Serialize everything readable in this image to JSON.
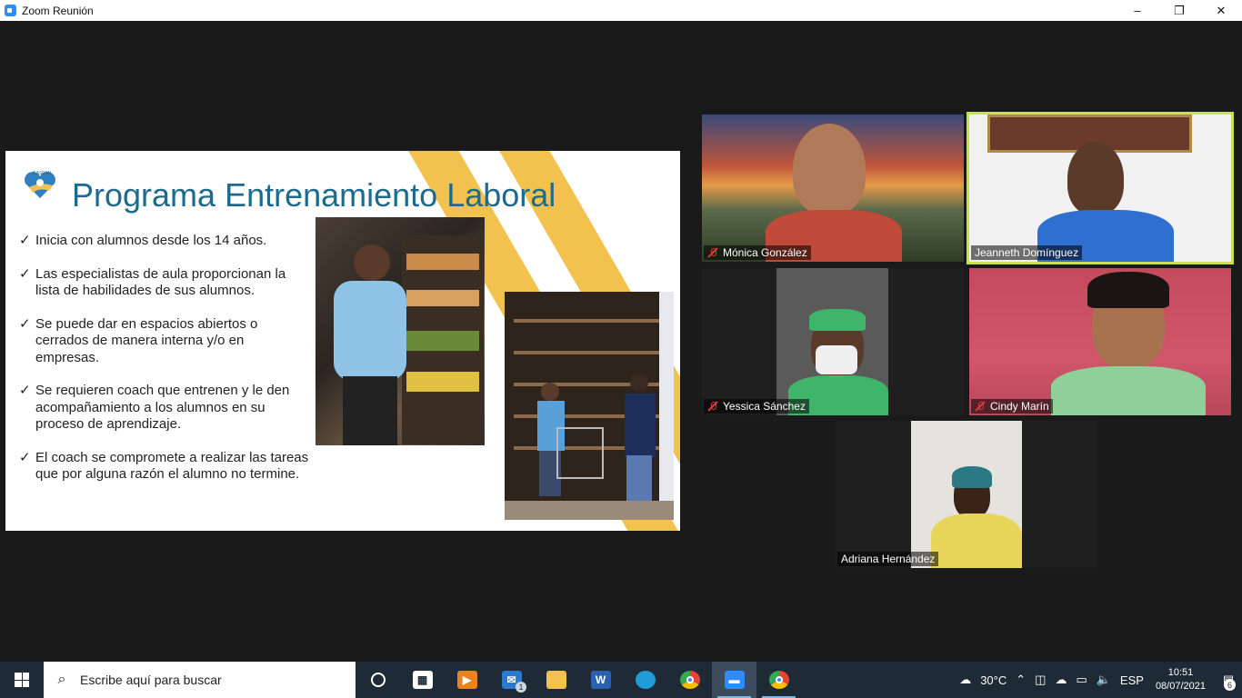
{
  "window": {
    "title": "Zoom Reunión",
    "minimize": "–",
    "maximize": "❐",
    "close": "✕"
  },
  "slide": {
    "title": "Programa Entrenamiento Laboral",
    "logo_text": "CASPAN",
    "check": "✓",
    "bullets": [
      "Inicia con alumnos desde los 14 años.",
      "Las especialistas  de aula  proporcionan la lista de habilidades de sus alumnos.",
      "Se puede dar en espacios abiertos o cerrados de manera interna y/o en empresas.",
      "Se requieren coach que entrenen y le den acompañamiento a los alumnos en su proceso de aprendizaje.",
      "El coach se compromete a realizar las tareas que por alguna razón el alumno no termine."
    ]
  },
  "participants": [
    {
      "name": "Mónica González",
      "muted": true
    },
    {
      "name": "Jeanneth Domínguez",
      "muted": false,
      "speaking": true
    },
    {
      "name": "Yessica Sánchez",
      "muted": true
    },
    {
      "name": "Cindy Marín",
      "muted": true
    },
    {
      "name": "Adriana Hernández",
      "muted": false
    }
  ],
  "taskbar": {
    "search_placeholder": "Escribe aquí para buscar",
    "mail_badge": "1",
    "weather": "30°C",
    "language": "ESP",
    "time": "10:51",
    "date": "08/07/2021",
    "notifications": "6",
    "icons": [
      "cortana-icon",
      "store-icon",
      "video-editor-icon",
      "mail-icon",
      "file-explorer-icon",
      "word-icon",
      "edge-icon",
      "chrome-icon",
      "zoom-icon",
      "chrome-profile-icon"
    ]
  },
  "colors": {
    "accent_title": "#1e6a8f",
    "slide_stripe": "#f2c14e",
    "active_speaker_border": "#c7e24a",
    "mute_red": "#e03b3b",
    "taskbar": "#1e2a36"
  }
}
